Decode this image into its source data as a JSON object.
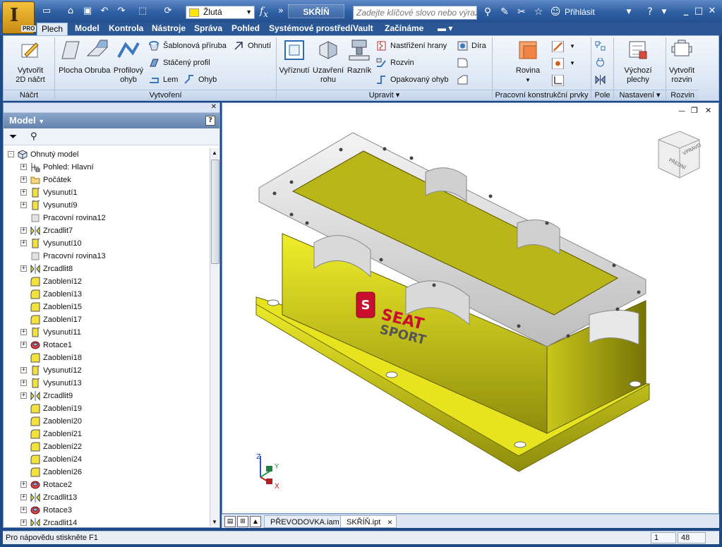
{
  "app": {
    "badge": "PRO",
    "doc_title": "SKŘÍŇ"
  },
  "qat": {
    "icons": [
      "new-icon",
      "open-icon",
      "save-icon",
      "undo-icon",
      "redo-icon",
      "select-icon",
      "update-icon"
    ],
    "color_value": "Žlutá",
    "color_swatch": "#ffe600"
  },
  "search": {
    "placeholder": "Zadejte klíčové slovo nebo výraz."
  },
  "signin_label": "Přihlásit",
  "tabs": [
    "Plech",
    "Model",
    "Kontrola",
    "Nástroje",
    "Správa",
    "Pohled",
    "Systémové prostředí",
    "Vault",
    "Začínáme"
  ],
  "active_tab": "Plech",
  "ribbon": {
    "nacrt": {
      "label": "Náčrt",
      "create_sketch": [
        "Vytvořit",
        "2D náčrt"
      ]
    },
    "vytvoreni": {
      "label": "Vytvoření",
      "plocha": "Plocha",
      "obruba": "Obruba",
      "profilovy": [
        "Profilový",
        "ohyb"
      ],
      "sablonova": "Šablonová příruba",
      "staceny": "Stáčený profil",
      "lem": "Lem",
      "ohnuti": "Ohnutí",
      "ohyb": "Ohyb"
    },
    "upravit": {
      "label": "Upravit",
      "vyriznuti": "Vyříznutí",
      "uzavreni": [
        "Uzavření",
        "rohu"
      ],
      "raznik": "Razník",
      "nastrizeni": "Nastřižení hrany",
      "rozvin": "Rozvin",
      "opakovany": "Opakovaný ohyb",
      "dira": "Díra"
    },
    "pracovni": {
      "label": "Pracovní konstrukční prvky",
      "rovina": "Rovina"
    },
    "pole": {
      "label": "Pole"
    },
    "nastaveni": {
      "label": "Nastavení",
      "vychozi": [
        "Výchozí",
        "plechy"
      ]
    },
    "rozvin": {
      "label": "Rozvin",
      "vytvorit": [
        "Vytvořit",
        "rozvin"
      ]
    }
  },
  "browser": {
    "title": "Model",
    "items": [
      {
        "label": "Ohnutý model",
        "icon": "part-icon",
        "level": 0,
        "exp": "-"
      },
      {
        "label": "Pohled: Hlavní",
        "icon": "view-icon",
        "level": 1,
        "exp": "+"
      },
      {
        "label": "Počátek",
        "icon": "folder-icon",
        "level": 1,
        "exp": "+"
      },
      {
        "label": "Vysunutí1",
        "icon": "extrude-icon",
        "level": 1,
        "exp": "+"
      },
      {
        "label": "Vysunutí9",
        "icon": "extrude-icon",
        "level": 1,
        "exp": "+"
      },
      {
        "label": "Pracovní rovina12",
        "icon": "plane-icon",
        "level": 1,
        "exp": ""
      },
      {
        "label": "Zrcadlit7",
        "icon": "mirror-icon",
        "level": 1,
        "exp": "+"
      },
      {
        "label": "Vysunutí10",
        "icon": "extrude-icon",
        "level": 1,
        "exp": "+"
      },
      {
        "label": "Pracovní rovina13",
        "icon": "plane-icon",
        "level": 1,
        "exp": ""
      },
      {
        "label": "Zrcadlit8",
        "icon": "mirror-icon",
        "level": 1,
        "exp": "+"
      },
      {
        "label": "Zaoblení12",
        "icon": "fillet-icon",
        "level": 1,
        "exp": ""
      },
      {
        "label": "Zaoblení13",
        "icon": "fillet-icon",
        "level": 1,
        "exp": ""
      },
      {
        "label": "Zaoblení15",
        "icon": "fillet-icon",
        "level": 1,
        "exp": ""
      },
      {
        "label": "Zaoblení17",
        "icon": "fillet-icon",
        "level": 1,
        "exp": ""
      },
      {
        "label": "Vysunutí11",
        "icon": "extrude-icon",
        "level": 1,
        "exp": "+"
      },
      {
        "label": "Rotace1",
        "icon": "revolve-icon",
        "level": 1,
        "exp": "+"
      },
      {
        "label": "Zaoblení18",
        "icon": "fillet-icon",
        "level": 1,
        "exp": ""
      },
      {
        "label": "Vysunutí12",
        "icon": "extrude-icon",
        "level": 1,
        "exp": "+"
      },
      {
        "label": "Vysunutí13",
        "icon": "extrude-icon",
        "level": 1,
        "exp": "+"
      },
      {
        "label": "Zrcadlit9",
        "icon": "mirror-icon",
        "level": 1,
        "exp": "+"
      },
      {
        "label": "Zaoblení19",
        "icon": "fillet-icon",
        "level": 1,
        "exp": ""
      },
      {
        "label": "Zaoblení20",
        "icon": "fillet-icon",
        "level": 1,
        "exp": ""
      },
      {
        "label": "Zaoblení21",
        "icon": "fillet-icon",
        "level": 1,
        "exp": ""
      },
      {
        "label": "Zaoblení22",
        "icon": "fillet-icon",
        "level": 1,
        "exp": ""
      },
      {
        "label": "Zaoblení24",
        "icon": "fillet-icon",
        "level": 1,
        "exp": ""
      },
      {
        "label": "Zaoblení26",
        "icon": "fillet-icon",
        "level": 1,
        "exp": ""
      },
      {
        "label": "Rotace2",
        "icon": "revolve-icon",
        "level": 1,
        "exp": "+"
      },
      {
        "label": "Zrcadlit13",
        "icon": "mirror-icon",
        "level": 1,
        "exp": "+"
      },
      {
        "label": "Rotace3",
        "icon": "revolve-icon",
        "level": 1,
        "exp": "+"
      },
      {
        "label": "Zrcadlit14",
        "icon": "mirror-icon",
        "level": 1,
        "exp": "+"
      }
    ]
  },
  "viewport": {
    "logo_text": [
      "SEAT",
      "SPORT"
    ],
    "viewcube_faces": [
      "PŘEDNÍ",
      "VPRAVO"
    ],
    "axes": [
      "Z",
      "Y",
      "X"
    ]
  },
  "doc_tabs": [
    "PŘEVODOVKA.iam",
    "SKŘÍŇ.ipt"
  ],
  "active_doc": "SKŘÍŇ.ipt",
  "status": {
    "help": "Pro nápovědu stiskněte F1",
    "num1": "1",
    "num2": "48"
  }
}
